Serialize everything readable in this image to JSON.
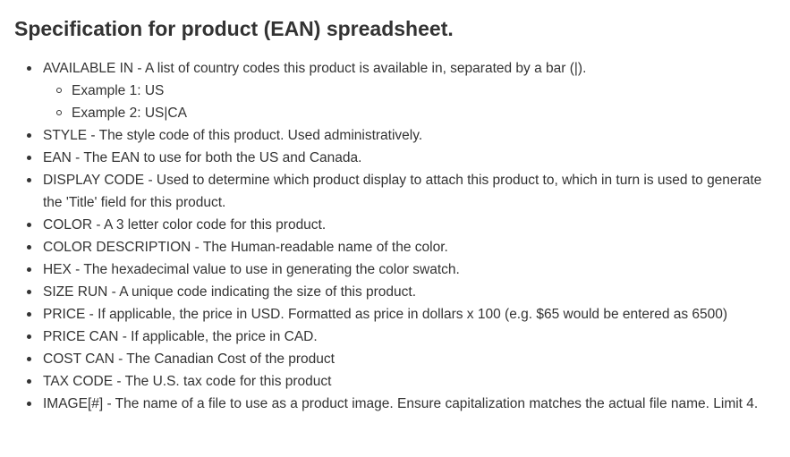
{
  "title": "Specification for product (EAN) spreadsheet.",
  "items": [
    {
      "text": "AVAILABLE IN - A list of country codes this product is available in, separated by a bar (|).",
      "sub": [
        "Example 1: US",
        "Example 2: US|CA"
      ]
    },
    {
      "text": "STYLE - The style code of this product. Used administratively."
    },
    {
      "text": "EAN - The EAN to use for both the US and Canada."
    },
    {
      "text": "DISPLAY CODE - Used to determine which product display to attach this product to, which in turn is used to generate the 'Title' field for this product."
    },
    {
      "text": "COLOR - A 3 letter color code for this product."
    },
    {
      "text": "COLOR DESCRIPTION - The Human-readable name of the color."
    },
    {
      "text": "HEX - The hexadecimal value to use in generating the color swatch."
    },
    {
      "text": "SIZE RUN - A unique code indicating the size of this product."
    },
    {
      "text": "PRICE - If applicable, the price in USD. Formatted as price in dollars x 100 (e.g. $65 would be entered as 6500)"
    },
    {
      "text": "PRICE CAN - If applicable, the price in CAD."
    },
    {
      "text": "COST CAN - The Canadian Cost of the product"
    },
    {
      "text": "TAX CODE - The U.S. tax code for this product"
    },
    {
      "text": "IMAGE[#] - The name of a file to use as a product image. Ensure capitalization matches the actual file name. Limit 4."
    }
  ]
}
